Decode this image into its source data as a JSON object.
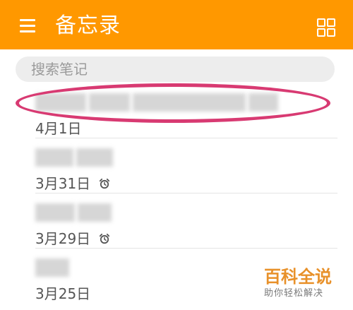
{
  "app_bar": {
    "title": "备忘录",
    "menu_icon": "hamburger-menu-icon",
    "view_icon": "grid-view-icon",
    "color": "#ff9800"
  },
  "search": {
    "placeholder": "搜索笔记",
    "value": ""
  },
  "notes": [
    {
      "date": "4月1日",
      "has_alarm": false
    },
    {
      "date": "3月31日",
      "has_alarm": true
    },
    {
      "date": "3月29日",
      "has_alarm": true
    },
    {
      "date": "3月25日",
      "has_alarm": false
    }
  ],
  "annotation": {
    "color": "#d83a72"
  },
  "watermark": {
    "main": "百科全说",
    "sub": "助你轻松解决"
  }
}
